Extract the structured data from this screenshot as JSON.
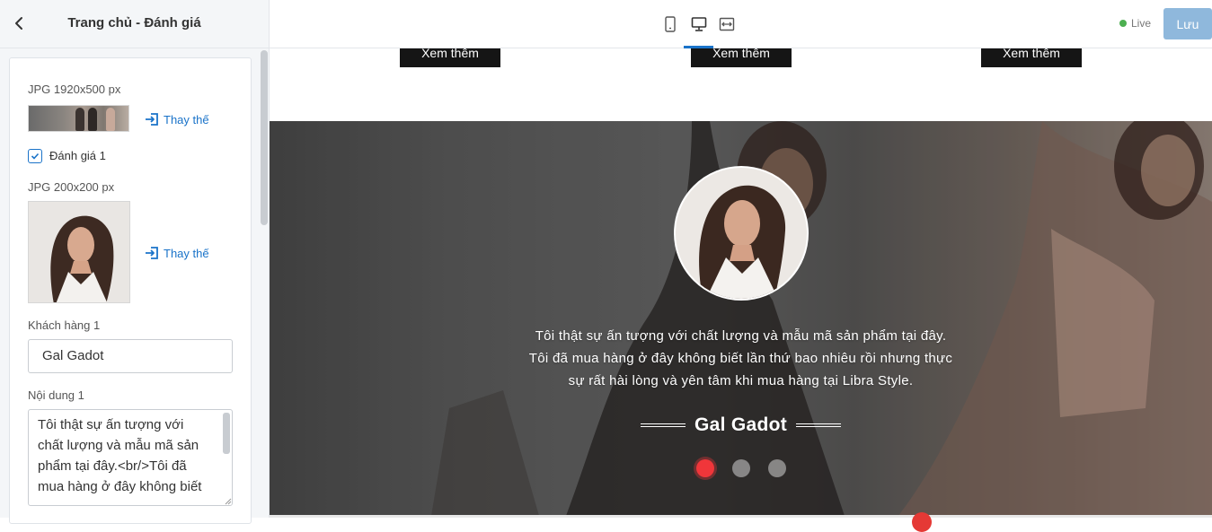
{
  "sidebar": {
    "title": "Trang chủ - Đánh giá",
    "background_image_label": "JPG 1920x500 px",
    "replace_label": "Thay thế",
    "review_checkbox_label": "Đánh giá 1",
    "review_checked": true,
    "avatar_image_label": "JPG 200x200 px",
    "customer_label": "Khách hàng 1",
    "customer_value": "Gal Gadot",
    "content_label": "Nội dung 1",
    "content_value": "Tôi thật sự ấn tượng với chất lượng và mẫu mã sản phẩm tại đây.<br/>Tôi đã mua hàng ở đây không biết"
  },
  "topbar": {
    "devices": [
      "mobile-icon",
      "desktop-icon",
      "fullwidth-icon"
    ],
    "active_device": "desktop",
    "live_label": "Live",
    "save_label": "Lưu"
  },
  "preview": {
    "more_buttons": [
      "Xem thêm",
      "Xem thêm",
      "Xem thêm"
    ],
    "testimonial": {
      "quote_lines": [
        "Tôi thật sự ấn tượng với chất lượng và mẫu mã sản phẩm tại đây.",
        "Tôi đã mua hàng ở đây không biết lần thứ bao nhiêu rồi nhưng thực",
        "sự rất hài lòng và yên tâm khi mua hàng tại Libra Style."
      ],
      "author": "Gal Gadot",
      "slide_count": 3,
      "active_slide": 1
    }
  },
  "colors": {
    "accent": "#1a73c9",
    "save_button": "#8fb8dc",
    "active_dot": "#f0363a",
    "live_dot": "#4caf50"
  }
}
